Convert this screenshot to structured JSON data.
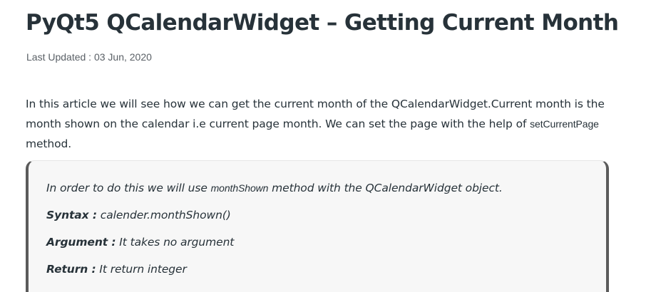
{
  "article": {
    "title": "PyQt5 QCalendarWidget – Getting Current Month",
    "last_updated": "Last Updated : 03 Jun, 2020",
    "intro": {
      "text_before_code": "In this article we will see how we can get the current month of the QCalendarWidget.Current month is the month shown on the calendar i.e current page month. We can set the page with the help of ",
      "code": "setCurrentPage",
      "text_after_code": " method."
    }
  },
  "note": {
    "line1": {
      "before": "In order to do this we will use ",
      "code": "monthShown",
      "after": " method with the QCalendarWidget object."
    },
    "syntax": {
      "label": "Syntax :",
      "value": " calender.monthShown()"
    },
    "argument": {
      "label": "Argument :",
      "value": " It takes no argument"
    },
    "return": {
      "label": "Return :",
      "value": " It return integer"
    }
  }
}
